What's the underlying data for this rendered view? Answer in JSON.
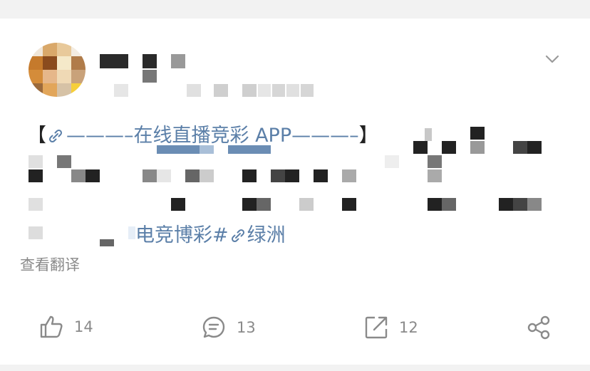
{
  "post": {
    "content": {
      "bracket_open": "【",
      "link_line": "———–在线直播竞彩 APP———–",
      "bracket_close": "】",
      "tag_text": "电竞博彩#",
      "tag2_text": "绿洲"
    },
    "translate_label": "查看翻译",
    "actions": {
      "like_count": "14",
      "comment_count": "13",
      "repost_count": "12"
    }
  },
  "colors": {
    "link": "#5b7fa8",
    "muted": "#8a8a8a"
  },
  "icons": {
    "link": "link-icon",
    "more": "chevron-down-icon",
    "like": "thumbs-up-icon",
    "comment": "comment-icon",
    "repost": "repost-icon",
    "share": "share-icon"
  }
}
